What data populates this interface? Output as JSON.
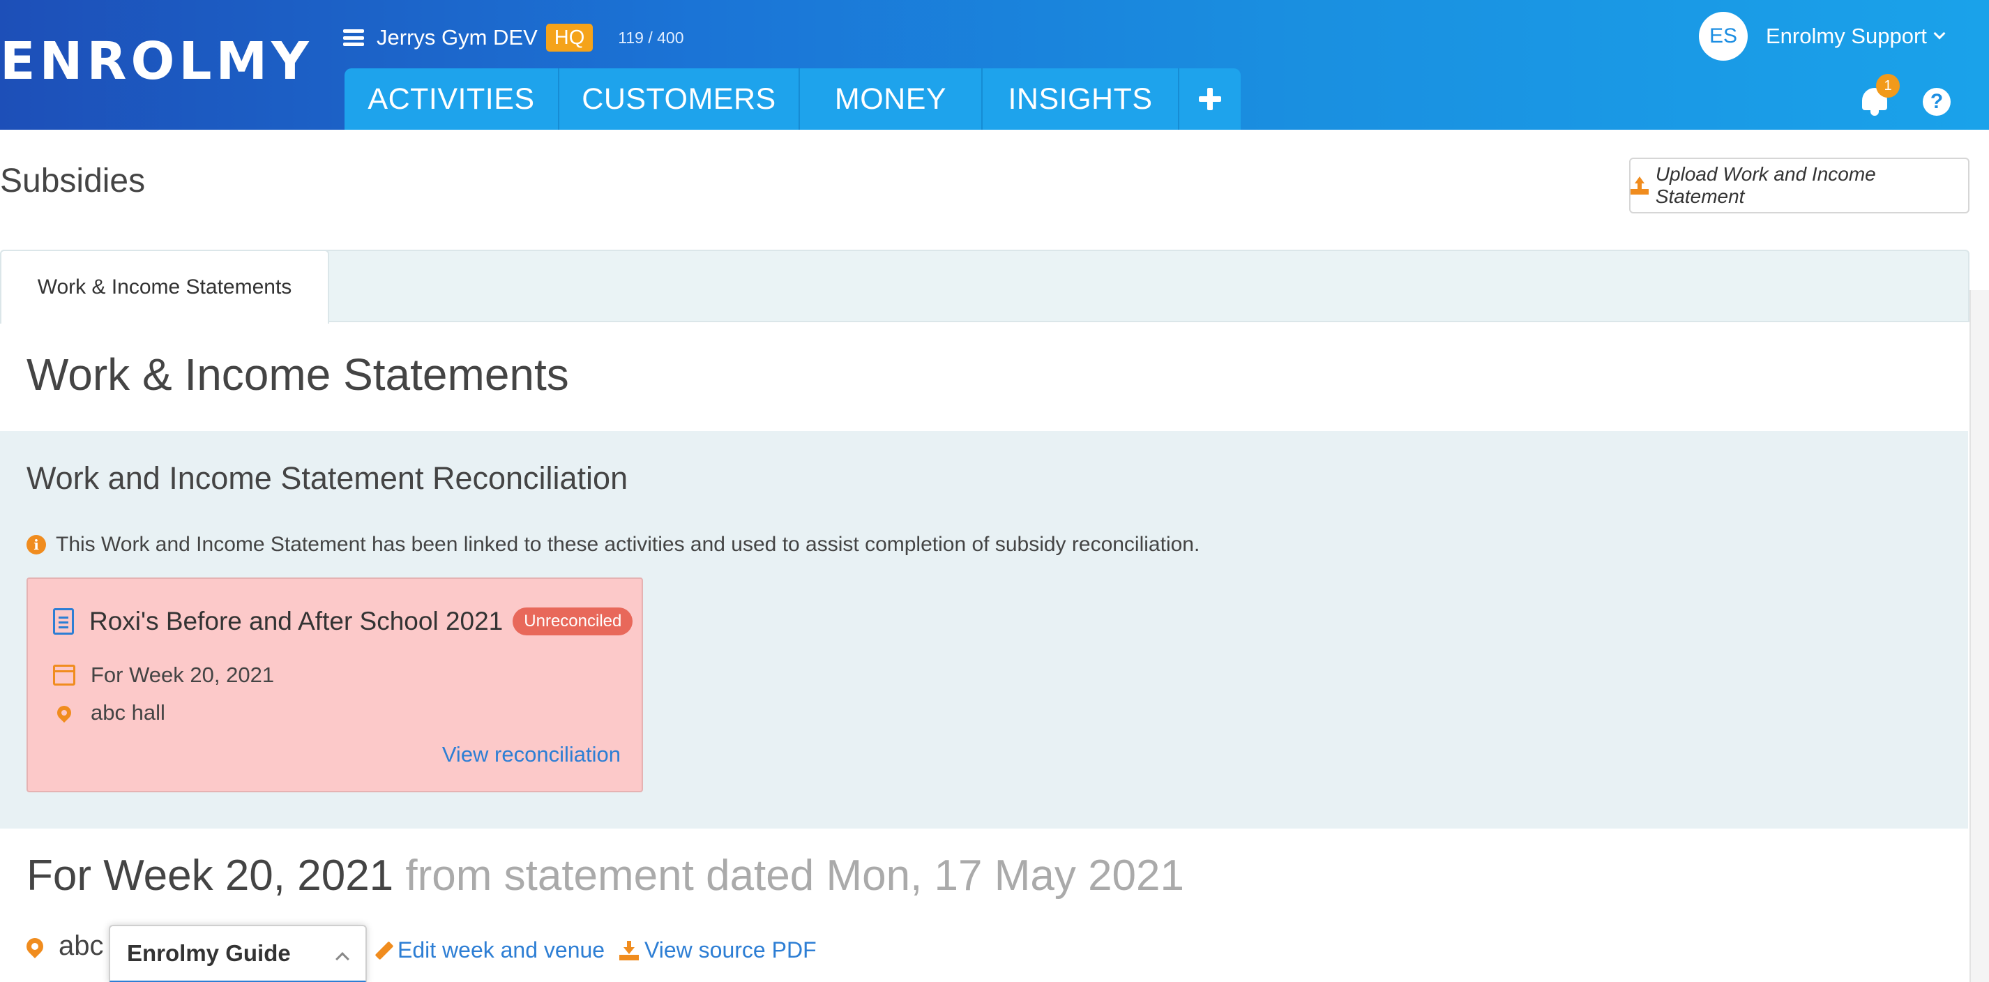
{
  "header": {
    "logo_text": "ENROLMY",
    "org_name": "Jerrys Gym DEV",
    "org_badge": "HQ",
    "org_count": "119 / 400",
    "nav_tabs": [
      "ACTIVITIES",
      "CUSTOMERS",
      "MONEY",
      "INSIGHTS"
    ],
    "user_initials": "ES",
    "user_name": "Enrolmy Support",
    "notification_count": "1",
    "help_glyph": "?"
  },
  "page": {
    "title": "Subsidies",
    "upload_button_label": "Upload Work and Income Statement"
  },
  "tabs": [
    "Work & Income Statements"
  ],
  "section_title": "Work & Income Statements",
  "reconciliation": {
    "heading": "Work and Income Statement Reconciliation",
    "info_text": "This Work and Income Statement has been linked to these activities and used to assist completion of subsidy reconciliation.",
    "card": {
      "title": "Roxi's Before and After School 2021",
      "status": "Unreconciled",
      "week": "For Week 20, 2021",
      "venue": "abc hall",
      "link_label": "View reconciliation"
    }
  },
  "week": {
    "heading": "For Week 20, 2021",
    "subheading": "from statement dated Mon, 17 May 2021",
    "venue_partial": "abc h",
    "edit_label": "Edit week and venue",
    "view_pdf_label": "View source PDF"
  },
  "guide": {
    "label": "Enrolmy Guide"
  },
  "colors": {
    "header_start": "#1d4fb8",
    "header_end": "#1aa2ea",
    "nav_bg": "#1ea3ec",
    "accent_orange": "#f08c1e",
    "hq_badge": "#f5a31a",
    "link_blue": "#2d7ed4",
    "unreconciled_card": "#fcc9c9",
    "unreconciled_badge": "#e8685a",
    "panel_bg": "#e8f1f4"
  },
  "icons": {
    "menu": "hamburger-icon",
    "add": "plus-icon",
    "notifications": "bell-icon",
    "help": "help-icon",
    "upload": "upload-icon",
    "info": "info-icon",
    "document": "document-icon",
    "calendar": "calendar-icon",
    "location": "map-pin-icon",
    "edit": "pencil-icon",
    "download": "download-icon"
  }
}
